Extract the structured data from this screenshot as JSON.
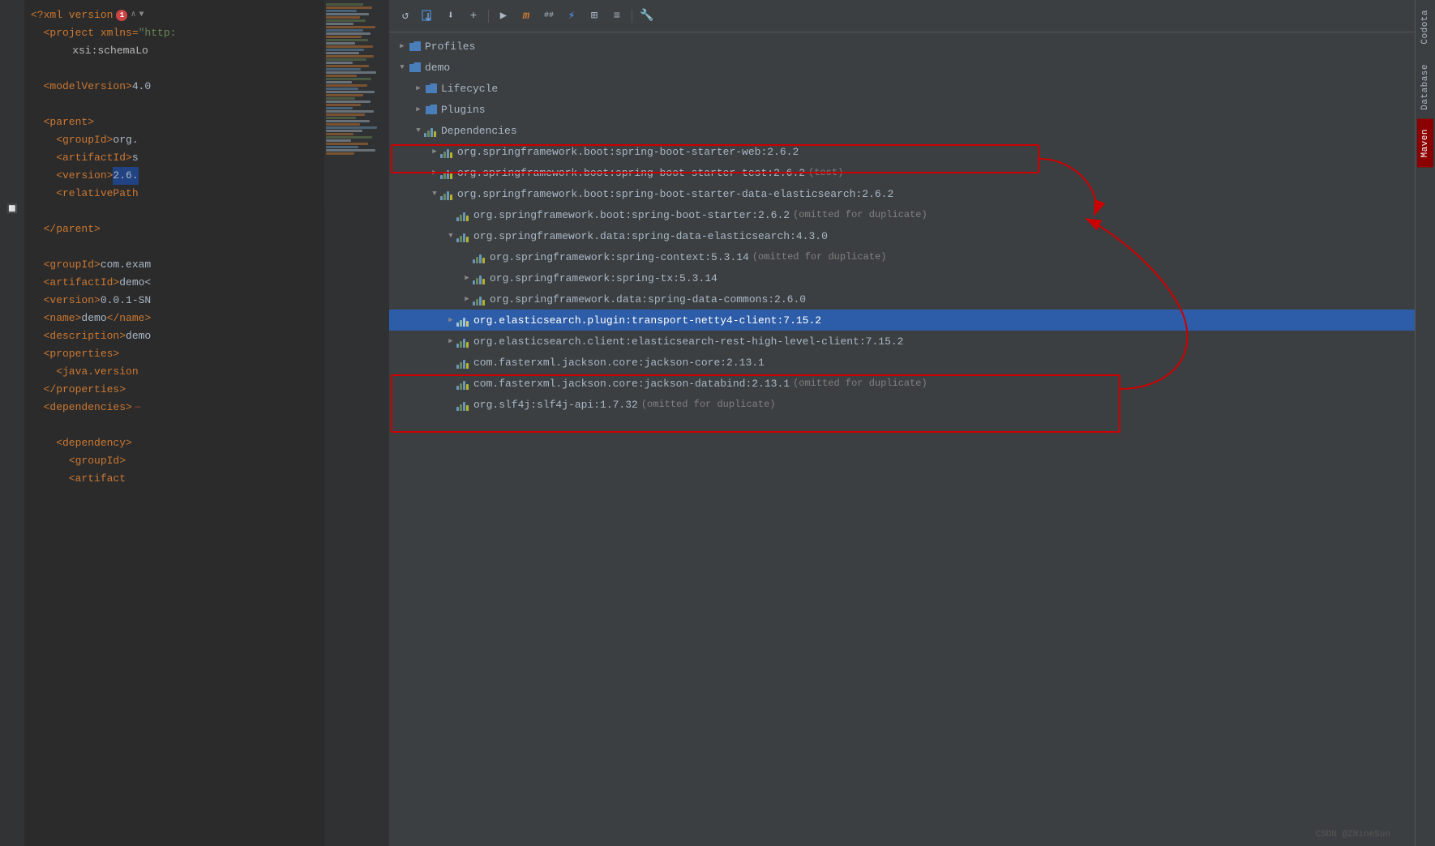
{
  "editor": {
    "lines": [
      {
        "indent": 0,
        "content": "<?xml versio",
        "type": "xml-header",
        "extra": "error"
      },
      {
        "indent": 0,
        "content": "  <project xmlns=\"http:",
        "type": "xml"
      },
      {
        "indent": 2,
        "content": "    xsi:schemaLo",
        "type": "xml-attr"
      },
      {
        "indent": 0,
        "content": "",
        "type": "blank"
      },
      {
        "indent": 0,
        "content": "  <modelVersion>4.0",
        "type": "xml"
      },
      {
        "indent": 0,
        "content": "",
        "type": "blank"
      },
      {
        "indent": 0,
        "content": "  <parent>",
        "type": "xml"
      },
      {
        "indent": 2,
        "content": "    <groupId>org.",
        "type": "xml"
      },
      {
        "indent": 2,
        "content": "    <artifactId>s",
        "type": "xml"
      },
      {
        "indent": 2,
        "content": "    <version>2.6.",
        "type": "xml-version-highlight"
      },
      {
        "indent": 2,
        "content": "    <relativePath",
        "type": "xml"
      },
      {
        "indent": 0,
        "content": "",
        "type": "blank"
      },
      {
        "indent": 0,
        "content": "  </parent>",
        "type": "xml"
      },
      {
        "indent": 0,
        "content": "",
        "type": "blank"
      },
      {
        "indent": 0,
        "content": "  <groupId>com.exam",
        "type": "xml"
      },
      {
        "indent": 0,
        "content": "  <artifactId>demo<",
        "type": "xml"
      },
      {
        "indent": 0,
        "content": "  <version>0.0.1-SN",
        "type": "xml"
      },
      {
        "indent": 0,
        "content": "  <name>demo</name>",
        "type": "xml"
      },
      {
        "indent": 0,
        "content": "  <description>demo",
        "type": "xml"
      },
      {
        "indent": 0,
        "content": "  <properties>",
        "type": "xml"
      },
      {
        "indent": 2,
        "content": "    <java.version",
        "type": "xml"
      },
      {
        "indent": 0,
        "content": "  </properties>",
        "type": "xml"
      },
      {
        "indent": 0,
        "content": "  <dependencies>",
        "type": "xml"
      },
      {
        "indent": 0,
        "content": "",
        "type": "blank"
      },
      {
        "indent": 2,
        "content": "    <dependency>",
        "type": "xml"
      },
      {
        "indent": 2,
        "content": "      <groupId>",
        "type": "xml"
      },
      {
        "indent": 2,
        "content": "      <artifact",
        "type": "xml"
      }
    ]
  },
  "toolbar": {
    "buttons": [
      "↺",
      "📁⬇",
      "⬇",
      "+",
      "▶",
      "m",
      "##",
      "⚡",
      "⊞",
      "≡",
      "🔧"
    ]
  },
  "maven_tree": {
    "title": "Maven",
    "items": [
      {
        "id": "profiles",
        "label": "Profiles",
        "indent": 0,
        "icon": "folder",
        "expanded": false,
        "arrow": "▶"
      },
      {
        "id": "demo",
        "label": "demo",
        "indent": 0,
        "icon": "folder",
        "expanded": true,
        "arrow": "▼"
      },
      {
        "id": "lifecycle",
        "label": "Lifecycle",
        "indent": 1,
        "icon": "folder",
        "expanded": false,
        "arrow": "▶"
      },
      {
        "id": "plugins",
        "label": "Plugins",
        "indent": 1,
        "icon": "folder",
        "expanded": false,
        "arrow": "▶"
      },
      {
        "id": "dependencies",
        "label": "Dependencies",
        "indent": 1,
        "icon": "dep",
        "expanded": true,
        "arrow": "▼"
      },
      {
        "id": "dep1",
        "label": "org.springframework.boot:spring-boot-starter-web:2.6.2",
        "indent": 2,
        "icon": "dep",
        "expanded": false,
        "arrow": "▶"
      },
      {
        "id": "dep2",
        "label": "org.springframework.boot:spring-boot-starter-test:2.6.2",
        "indent": 2,
        "icon": "dep",
        "expanded": false,
        "arrow": "▶",
        "badge": "(test)"
      },
      {
        "id": "dep3",
        "label": "org.springframework.boot:spring-boot-starter-data-elasticsearch:2.6.2",
        "indent": 2,
        "icon": "dep",
        "expanded": true,
        "arrow": "▼"
      },
      {
        "id": "dep3-1",
        "label": "org.springframework.boot:spring-boot-starter:2.6.2",
        "indent": 3,
        "icon": "dep",
        "badge": "(omitted for duplicate)"
      },
      {
        "id": "dep3-2",
        "label": "org.springframework.data:spring-data-elasticsearch:4.3.0",
        "indent": 3,
        "icon": "dep",
        "expanded": true,
        "arrow": "▼"
      },
      {
        "id": "dep3-2-1",
        "label": "org.springframework:spring-context:5.3.14",
        "indent": 4,
        "icon": "dep",
        "badge": "(omitted for duplicate)"
      },
      {
        "id": "dep3-2-2",
        "label": "org.springframework:spring-tx:5.3.14",
        "indent": 4,
        "icon": "dep",
        "expanded": false,
        "arrow": "▶"
      },
      {
        "id": "dep3-2-3",
        "label": "org.springframework.data:spring-data-commons:2.6.0",
        "indent": 4,
        "icon": "dep",
        "expanded": false,
        "arrow": "▶"
      },
      {
        "id": "dep4",
        "label": "org.elasticsearch.plugin:transport-netty4-client:7.15.2",
        "indent": 3,
        "icon": "dep",
        "expanded": false,
        "arrow": "▶",
        "selected": true
      },
      {
        "id": "dep5",
        "label": "org.elasticsearch.client:elasticsearch-rest-high-level-client:7.15.2",
        "indent": 3,
        "icon": "dep",
        "expanded": false,
        "arrow": "▶"
      },
      {
        "id": "dep6",
        "label": "com.fasterxml.jackson.core:jackson-core:2.13.1",
        "indent": 3,
        "icon": "dep"
      },
      {
        "id": "dep7",
        "label": "com.fasterxml.jackson.core:jackson-databind:2.13.1",
        "indent": 3,
        "icon": "dep",
        "badge": "(omitted for duplicate)"
      },
      {
        "id": "dep8",
        "label": "org.slf4j:slf4j-api:1.7.32",
        "indent": 3,
        "icon": "dep",
        "badge": "(omitted for duplicate)"
      }
    ]
  },
  "sidebar": {
    "tabs": [
      {
        "label": "Codota",
        "active": false
      },
      {
        "label": "Database",
        "active": false
      },
      {
        "label": "Maven",
        "active": true
      }
    ]
  },
  "watermark": "CSDN @ZNineSun"
}
